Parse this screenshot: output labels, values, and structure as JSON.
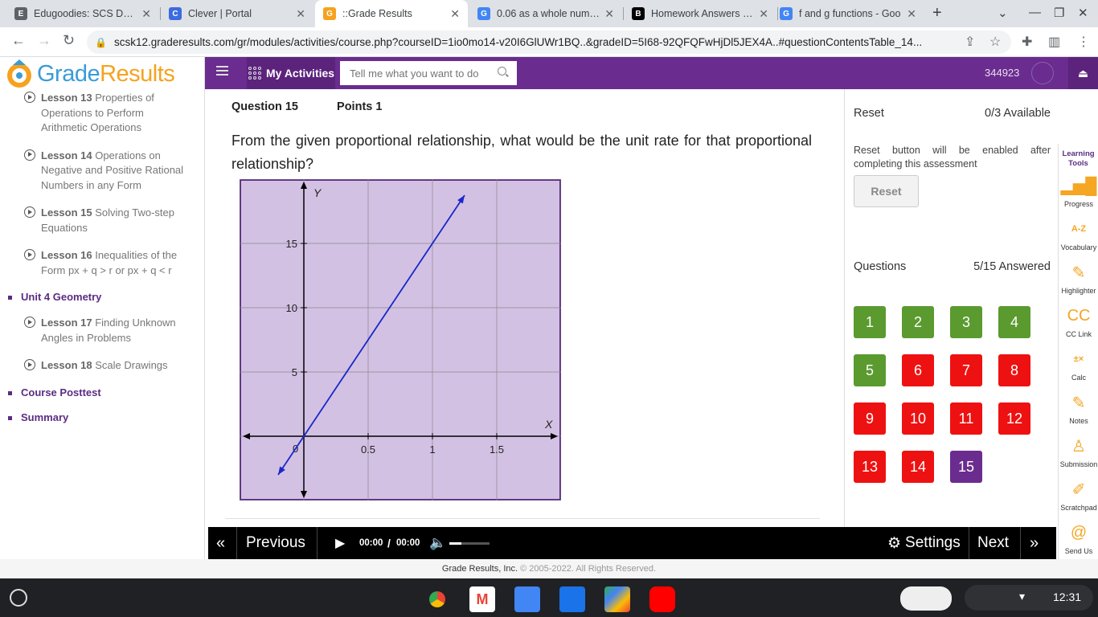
{
  "browser": {
    "tabs": [
      {
        "title": "Edugoodies: SCS Daily",
        "favicon": "E",
        "color": "#5f6368"
      },
      {
        "title": "Clever | Portal",
        "favicon": "C",
        "color": "#3d6adf"
      },
      {
        "title": "::Grade Results",
        "favicon": "G",
        "color": "#f6a21e"
      },
      {
        "title": "0.06 as a whole numbe",
        "favicon": "G",
        "color": "#4285f4"
      },
      {
        "title": "Homework Answers fro",
        "favicon": "B",
        "color": "#000000"
      },
      {
        "title": "f and g functions - Goo",
        "favicon": "G",
        "color": "#4285f4"
      }
    ],
    "url": "scsk12.graderesults.com/gr/modules/activities/course.php?courseID=1io0mo14-v20I6GlUWr1BQ..&gradeID=5I68-92QFQFwHjDl5JEX4A..#questionContentsTable_14..."
  },
  "logo": {
    "part1": "Grade",
    "part2": "Results"
  },
  "sidebar": {
    "lessons_a": [
      {
        "num": "Lesson 13",
        "title": "Properties of Operations to Perform Arithmetic Operations"
      },
      {
        "num": "Lesson 14",
        "title": "Operations on Negative and Positive Rational Numbers in any Form"
      },
      {
        "num": "Lesson 15",
        "title": "Solving Two-step Equations"
      },
      {
        "num": "Lesson 16",
        "title": "Inequalities of the Form px + q > r or px + q < r"
      }
    ],
    "unit4": "Unit 4 Geometry",
    "lessons_b": [
      {
        "num": "Lesson 17",
        "title": "Finding Unknown Angles in Problems"
      },
      {
        "num": "Lesson 18",
        "title": "Scale Drawings"
      }
    ],
    "posttest": "Course Posttest",
    "summary": "Summary"
  },
  "topbar": {
    "my_activities": "My Activities",
    "search_placeholder": "Tell me what you want to do",
    "user_id": "344923"
  },
  "question": {
    "label": "Question 15",
    "points": "Points 1",
    "text": "From the given proportional relationship, what would be the unit rate for that proportional relationship?"
  },
  "chart_data": {
    "type": "line",
    "xlabel": "X",
    "ylabel": "Y",
    "xlim": [
      -0.5,
      2.0
    ],
    "ylim": [
      -5,
      20
    ],
    "x_ticks": [
      "0.5",
      "1",
      "1.5"
    ],
    "y_ticks": [
      "5",
      "10",
      "15"
    ],
    "origin_label": "0",
    "grid": true,
    "background": "#d3c1e4",
    "line_color": "#1a27c9",
    "series": [
      {
        "x": [
          -0.2,
          1.25
        ],
        "y": [
          -3,
          18.75
        ]
      }
    ]
  },
  "right_panel": {
    "reset_label": "Reset",
    "reset_available": "0/3 Available",
    "reset_note": "Reset button will be enabled after completing this assessment",
    "reset_button": "Reset",
    "questions_label": "Questions",
    "questions_answered": "5/15 Answered",
    "question_buttons": [
      {
        "n": "1",
        "color": "#5b9a2f"
      },
      {
        "n": "2",
        "color": "#5b9a2f"
      },
      {
        "n": "3",
        "color": "#5b9a2f"
      },
      {
        "n": "4",
        "color": "#5b9a2f"
      },
      {
        "n": "5",
        "color": "#5b9a2f"
      },
      {
        "n": "6",
        "color": "#ee1111"
      },
      {
        "n": "7",
        "color": "#ee1111"
      },
      {
        "n": "8",
        "color": "#ee1111"
      },
      {
        "n": "9",
        "color": "#ee1111"
      },
      {
        "n": "10",
        "color": "#ee1111"
      },
      {
        "n": "11",
        "color": "#ee1111"
      },
      {
        "n": "12",
        "color": "#ee1111"
      },
      {
        "n": "13",
        "color": "#ee1111"
      },
      {
        "n": "14",
        "color": "#ee1111"
      },
      {
        "n": "15",
        "color": "#6a2c8e"
      }
    ]
  },
  "tools": {
    "title": "Learning Tools",
    "items": [
      "Progress",
      "Vocabulary",
      "Highlighter",
      "CC Link",
      "Calc",
      "Notes",
      "Submission",
      "Scratchpad",
      "Send Us"
    ]
  },
  "player": {
    "previous": "Previous",
    "time_current": "00:00",
    "time_sep": "/",
    "time_total": "00:00",
    "settings": "Settings",
    "next": "Next"
  },
  "footer": {
    "company": "Grade Results, Inc.",
    "copyright": "© 2005-2022. All Rights Reserved."
  },
  "taskbar": {
    "time": "12:31"
  }
}
